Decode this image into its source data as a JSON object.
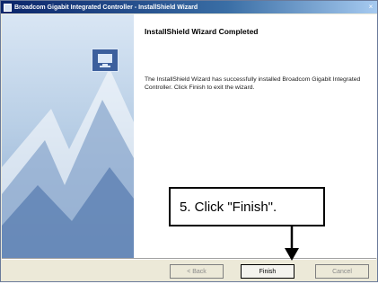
{
  "window": {
    "title": "Broadcom Gigabit Integrated Controller - InstallShield Wizard",
    "close_glyph": "×"
  },
  "content": {
    "heading": "InstallShield Wizard Completed",
    "body": "The InstallShield Wizard has successfully installed Broadcom Gigabit Integrated Controller. Click Finish to exit the wizard."
  },
  "buttons": {
    "back": "< Back",
    "finish": "Finish",
    "cancel": "Cancel"
  },
  "annotation": {
    "text": "5. Click \"Finish\"."
  },
  "icons": {
    "app": "installer-icon",
    "logo": "computer-logo-icon",
    "close": "close-icon",
    "pointer": "down-arrow-icon"
  }
}
